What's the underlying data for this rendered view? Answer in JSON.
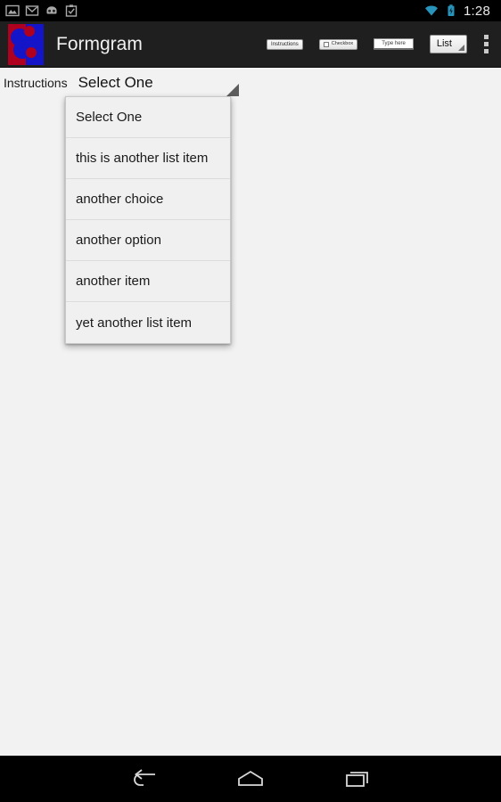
{
  "statusbar": {
    "time": "1:28",
    "left_icons": [
      "image-icon",
      "gmail-icon",
      "cyanogenmod-icon",
      "clipboard-check-icon"
    ],
    "right_icons": [
      "wifi-icon",
      "battery-charging-icon"
    ],
    "accent_color": "#33b5e5",
    "background": "#000000"
  },
  "actionbar": {
    "app_title": "Formgram",
    "logo_name": "formgram-logo",
    "logo_colors": {
      "red": "#b00020",
      "blue": "#1414c8"
    },
    "background": "#1f1f1f",
    "actions": {
      "instructions_label": "Instructions",
      "checkbox_label": "Checkbox",
      "textfield_placeholder": "Type here",
      "spinner_label": "List",
      "overflow_name": "overflow-menu"
    }
  },
  "form": {
    "label": "Instructions",
    "spinner_value": "Select One"
  },
  "dropdown": {
    "open": true,
    "items": [
      {
        "label": "Select One"
      },
      {
        "label": "this is another list item"
      },
      {
        "label": "another choice"
      },
      {
        "label": "another option"
      },
      {
        "label": "another item"
      },
      {
        "label": "yet another list item"
      }
    ]
  },
  "navbar": {
    "buttons": [
      "back-icon",
      "home-icon",
      "recents-icon"
    ],
    "background": "#000000"
  }
}
